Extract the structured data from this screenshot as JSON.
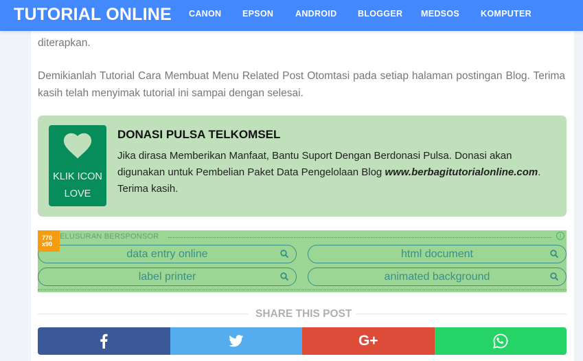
{
  "header": {
    "brand": "TUTORIAL ONLINE",
    "nav": [
      {
        "label": "CANON"
      },
      {
        "label": "EPSON"
      },
      {
        "label": "ANDROID"
      },
      {
        "label": "BLOGGER"
      },
      {
        "label": "MEDSOS"
      },
      {
        "label": "KOMPUTER"
      }
    ]
  },
  "article": {
    "paragraph_1": "diterapkan.",
    "paragraph_2": "Demikianlah Tutorial Cara Membuat Menu Related Post Otomtasi pada setiap halaman postingan Blog. Terima kasih telah menyimak tutorial ini sampai dengan selesai."
  },
  "donation": {
    "icon": "heart-icon",
    "icon_label_line1": "KLIK ICON",
    "icon_label_line2": "LOVE",
    "title": "DONASI PULSA TELKOMSEL",
    "body_before": "Jika dirasa Memberikan Manfaat, Bantu Suport Dengan Berdonasi Pulsa. Donasi akan digunakan untuk Pembelian Paket Data Pengelolaan Blog ",
    "body_link": "www.berbagitutorialonline.com",
    "body_after": ". Terima kasih.",
    "colors": {
      "box": "#c0dfbb",
      "icon_bg": "#078c5b"
    }
  },
  "ads": {
    "size_line1": "770",
    "size_line2": "x90",
    "label": "ELUSURAN BERSPONSOR",
    "info_icon": "i",
    "searches": [
      {
        "label": "data entry online"
      },
      {
        "label": "html document"
      },
      {
        "label": "label printer"
      },
      {
        "label": "animated background"
      }
    ]
  },
  "share": {
    "title": "SHARE THIS POST",
    "buttons": [
      {
        "name": "facebook",
        "icon": "facebook-icon",
        "color": "#3b5998"
      },
      {
        "name": "twitter",
        "icon": "twitter-icon",
        "color": "#55acee"
      },
      {
        "name": "google-plus",
        "icon": "google-plus-icon",
        "label": "G+",
        "color": "#dd4b39"
      },
      {
        "name": "whatsapp",
        "icon": "whatsapp-icon",
        "color": "#25d366"
      }
    ]
  },
  "colors": {
    "navbar": "#4488fd",
    "page_bg": "#f0f3f8"
  }
}
